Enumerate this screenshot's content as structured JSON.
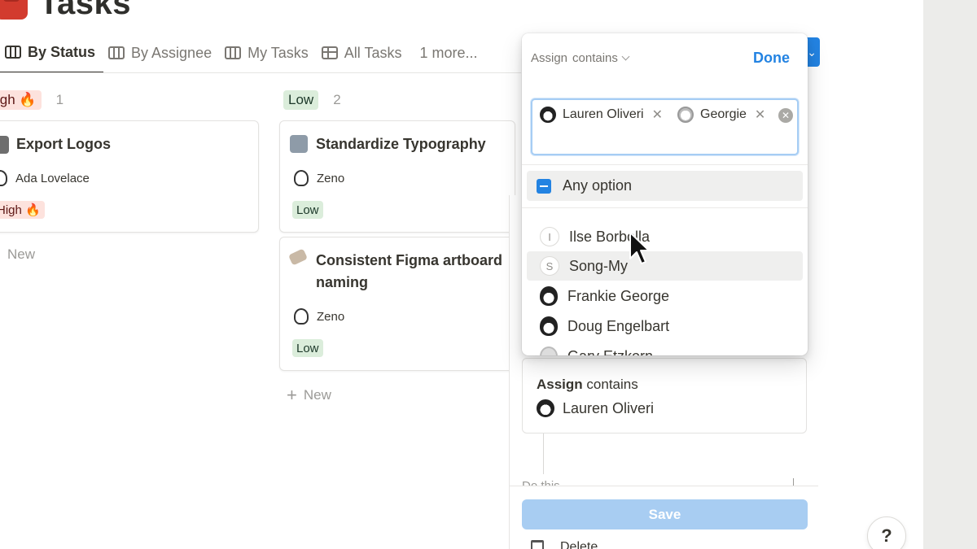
{
  "page": {
    "title": "Tasks"
  },
  "tabs": [
    {
      "label": "By Status",
      "icon": "board-icon",
      "active": true
    },
    {
      "label": "By Assignee",
      "icon": "board-icon"
    },
    {
      "label": "My Tasks",
      "icon": "board-icon"
    },
    {
      "label": "All Tasks",
      "icon": "table-icon"
    },
    {
      "label": "1 more...",
      "icon": ""
    }
  ],
  "columns": [
    {
      "tag": "igh 🔥",
      "count": "1",
      "cards": [
        {
          "title": "Export Logos",
          "assignee": "Ada Lovelace",
          "priority": "High 🔥"
        }
      ],
      "new_label": "New"
    },
    {
      "tag": "Low",
      "count": "2",
      "cards": [
        {
          "title": "Standardize Typography",
          "assignee": "Zeno",
          "priority": "Low"
        },
        {
          "title_line1": "Consistent Figma artboard",
          "title_line2": "naming",
          "assignee": "Zeno",
          "priority": "Low"
        }
      ],
      "new_label": "New"
    }
  ],
  "popup": {
    "property": "Assign",
    "operator": "contains",
    "done_label": "Done",
    "tokens": [
      "Lauren Oliveri",
      "Georgie"
    ],
    "any_option_label": "Any option",
    "options": [
      {
        "initial": "I",
        "name": "Ilse Borbolla"
      },
      {
        "initial": "S",
        "name": "Song-My"
      },
      {
        "name": "Frankie George"
      },
      {
        "name": "Doug Engelbart"
      },
      {
        "name": "Gary Etzkorn"
      }
    ]
  },
  "rule": {
    "label_bold": "Assign",
    "label_rest": "contains",
    "person": "Lauren Oliveri",
    "do_this": "Do this",
    "save_label": "Save",
    "delete_label": "Delete"
  },
  "help_label": "?",
  "colors": {
    "accent": "#2383e2",
    "save_disabled": "#a8cdf2",
    "high_bg": "#fde2dd",
    "low_bg": "#dbeddb"
  }
}
